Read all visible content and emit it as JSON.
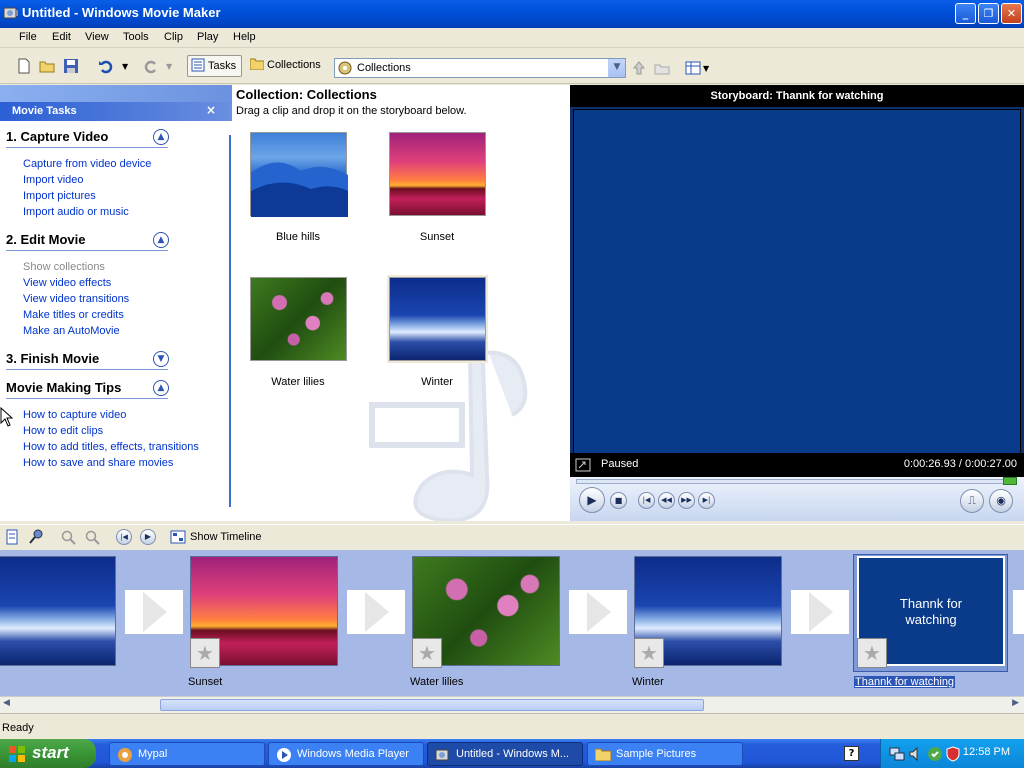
{
  "window": {
    "title": "Untitled - Windows Movie Maker"
  },
  "menu": [
    "File",
    "Edit",
    "View",
    "Tools",
    "Clip",
    "Play",
    "Help"
  ],
  "toolbar": {
    "tasks_label": "Tasks",
    "collections_label": "Collections",
    "collection_select": "Collections"
  },
  "tasks": {
    "header": "Movie Tasks",
    "sections": [
      {
        "title": "1. Capture Video",
        "expanded": true,
        "links": [
          "Capture from video device",
          "Import video",
          "Import pictures",
          "Import audio or music"
        ]
      },
      {
        "title": "2. Edit Movie",
        "expanded": true,
        "links": [
          "Show collections",
          "View video effects",
          "View video transitions",
          "Make titles or credits",
          "Make an AutoMovie"
        ],
        "disabled": [
          0
        ]
      },
      {
        "title": "3. Finish Movie",
        "expanded": false,
        "links": []
      },
      {
        "title": "Movie Making Tips",
        "expanded": true,
        "links": [
          "How to capture video",
          "How to edit clips",
          "How to add titles, effects, transitions",
          "How to save and share movies"
        ]
      }
    ]
  },
  "collection": {
    "title": "Collection: Collections",
    "subtitle": "Drag a clip and drop it on the storyboard below.",
    "items": [
      {
        "name": "Blue hills"
      },
      {
        "name": "Sunset"
      },
      {
        "name": "Water lilies"
      },
      {
        "name": "Winter"
      }
    ]
  },
  "preview": {
    "title": "Storyboard: Thannk for watching",
    "state": "Paused",
    "time": "0:00:26.93 / 0:00:27.00"
  },
  "storyboard_toolbar": {
    "show_timeline": "Show Timeline"
  },
  "storyboard": {
    "clips": [
      {
        "label": ""
      },
      {
        "label": "Sunset"
      },
      {
        "label": "Water lilies"
      },
      {
        "label": "Winter"
      },
      {
        "label": "Thannk for watching"
      }
    ],
    "title_card": {
      "line1": "Thannk for",
      "line2": "watching"
    }
  },
  "status": "Ready",
  "taskbar": {
    "start": "start",
    "tasks": [
      {
        "label": "Mypal"
      },
      {
        "label": "Windows Media Player"
      },
      {
        "label": "Untitled - Windows M..."
      },
      {
        "label": "Sample Pictures"
      }
    ],
    "clock": "12:58 PM"
  },
  "colors": {
    "accent": "#0054e3",
    "preview_bg": "#0a3b8a",
    "link": "#0033cc"
  }
}
